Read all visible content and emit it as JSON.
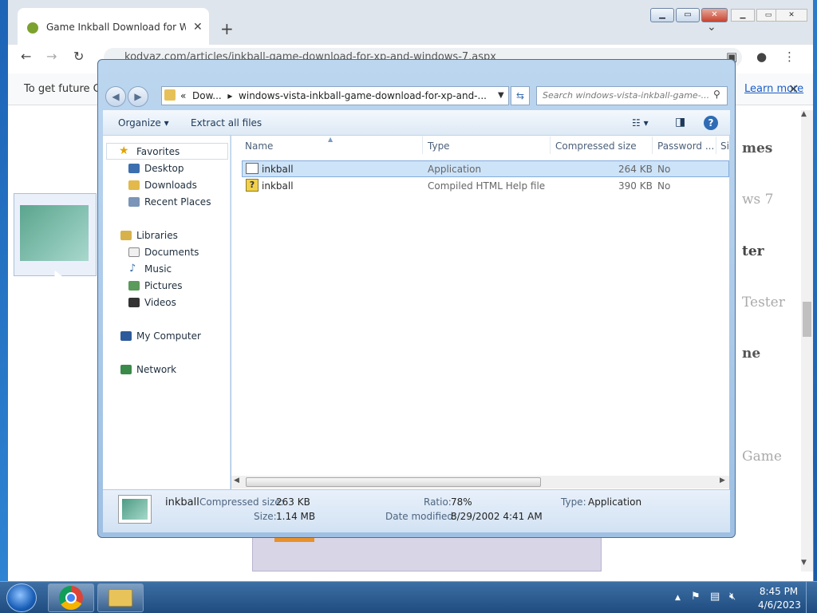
{
  "browser": {
    "tab_title": "Game Inkball Download for Windows XP",
    "tab_close": "✕",
    "new_tab": "+",
    "tab_search": "⌄",
    "url": "kodyaz.com/articles/inkball-game-download-for-xp-and-windows-7.aspx",
    "back": "←",
    "forward": "→",
    "reload": "↻",
    "infobar_text": "To get future Go",
    "infobar_link": "Learn more",
    "infobar_close": "✕",
    "page_texts": [
      "mes",
      "ws 7",
      "ter",
      "Tester",
      "ne",
      "Game"
    ]
  },
  "explorer": {
    "minimize": "▁",
    "maximize": "▭",
    "close": "✕",
    "breadcrumb_prefix": "«",
    "crumb1": "Dow...",
    "crumb_sep": "▸",
    "crumb2": "windows-vista-inkball-game-download-for-xp-and-...",
    "search_placeholder": "Search windows-vista-inkball-game-...",
    "toolbar": {
      "organize": "Organize",
      "extract": "Extract all files"
    },
    "nav": {
      "favorites": "Favorites",
      "desktop": "Desktop",
      "downloads": "Downloads",
      "recent": "Recent Places",
      "libraries": "Libraries",
      "documents": "Documents",
      "music": "Music",
      "pictures": "Pictures",
      "videos": "Videos",
      "computer": "My Computer",
      "network": "Network"
    },
    "columns": {
      "name": "Name",
      "type": "Type",
      "compressed": "Compressed size",
      "password": "Password ...",
      "size": "Si"
    },
    "files": [
      {
        "name": "inkball",
        "type": "Application",
        "compressed": "264 KB",
        "password": "No"
      },
      {
        "name": "inkball",
        "type": "Compiled HTML Help file",
        "compressed": "390 KB",
        "password": "No"
      }
    ],
    "details": {
      "name": "inkball",
      "compressed_label": "Compressed size:",
      "compressed_value": "263 KB",
      "size_label": "Size:",
      "size_value": "1.14 MB",
      "ratio_label": "Ratio:",
      "ratio_value": "78%",
      "modified_label": "Date modified:",
      "modified_value": "8/29/2002 4:41 AM",
      "type_label": "Type:",
      "type_value": "Application"
    }
  },
  "taskbar": {
    "time": "8:45 PM",
    "date": "4/6/2023"
  }
}
